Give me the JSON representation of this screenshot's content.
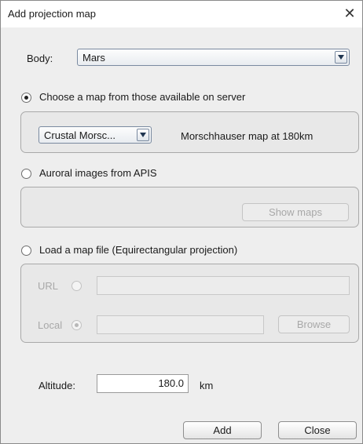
{
  "window": {
    "title": "Add projection map",
    "close_glyph": "✕"
  },
  "body_row": {
    "label": "Body:",
    "value": "Mars"
  },
  "option_server": {
    "label": "Choose a map from those available on server",
    "selected": true,
    "map_select": "Crustal Morsc...",
    "map_description": "Morschhauser map at 180km"
  },
  "option_apis": {
    "label": "Auroral images from APIS",
    "selected": false,
    "show_maps_label": "Show maps"
  },
  "option_file": {
    "label": "Load a map file (Equirectangular projection)",
    "selected": false,
    "url_label": "URL",
    "url_value": "",
    "local_label": "Local",
    "local_value": "",
    "browse_label": "Browse"
  },
  "altitude": {
    "label": "Altitude:",
    "value": "180.0",
    "unit": "km"
  },
  "footer": {
    "add_label": "Add",
    "close_label": "Close"
  }
}
